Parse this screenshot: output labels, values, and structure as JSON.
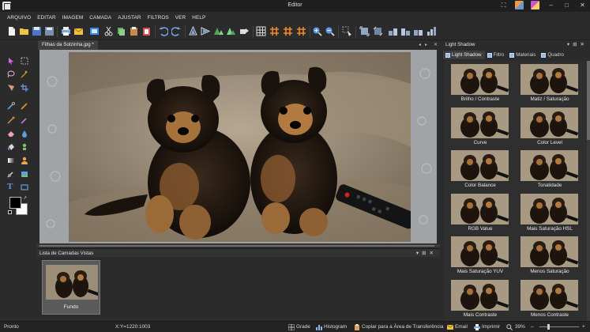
{
  "window": {
    "title": "Editor"
  },
  "menu": [
    "ARQUIVO",
    "EDITAR",
    "IMAGEM",
    "CAMADA",
    "AJUSTAR",
    "FILTROS",
    "VER",
    "HELP"
  ],
  "document": {
    "tab_label": "Filhas da Solzinha.jpg *"
  },
  "layers_panel": {
    "title": "Lista de Camadas Vistas",
    "layers": [
      {
        "name": "Fundo"
      }
    ]
  },
  "effects_panel": {
    "title": "Light Shadow",
    "tabs": [
      {
        "label": "Light Shadow",
        "active": true
      },
      {
        "label": "Filtro",
        "active": false
      },
      {
        "label": "Materiais",
        "active": false
      },
      {
        "label": "Quadro",
        "active": false
      }
    ],
    "items": [
      "Brilho / Contraste",
      "Matiz / Saturação",
      "Curve",
      "Color Level",
      "Color Balance",
      "Tonalidade",
      "RGB Value",
      "Mais Saturação HSL",
      "Mais Saturação YUV",
      "Menos Saturação",
      "Mais Contraste",
      "Menos Contraste"
    ]
  },
  "status": {
    "ready": "Pronto",
    "coords": "X:Y=1220:1003",
    "grid": "Grade",
    "histogram": "Histogram",
    "copy": "Copiar para a Área de Transferência",
    "email": "Email",
    "print": "Imprimir",
    "zoom": "39%"
  },
  "colors": {
    "accent": "#4f8fd8",
    "panel": "#2b2b2b",
    "canvas_bg": "#a0a4a6"
  }
}
